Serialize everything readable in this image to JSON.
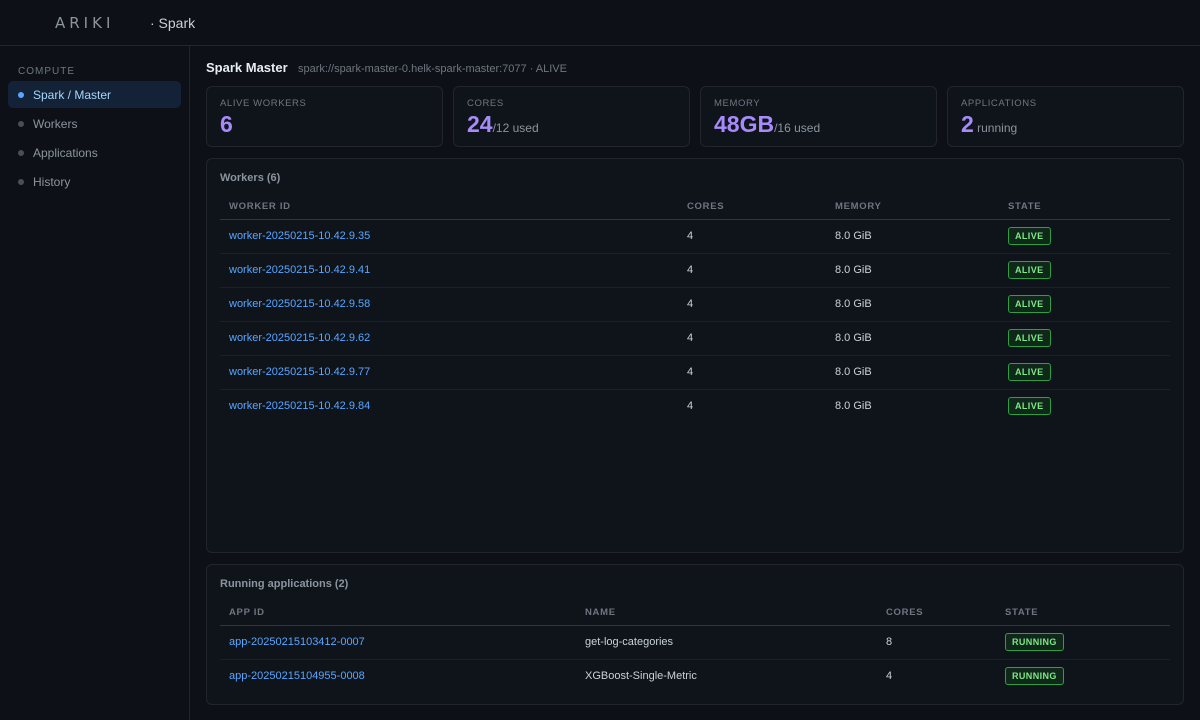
{
  "header": {
    "logo": "ARIKI",
    "app_name": "· Spark"
  },
  "sidebar": {
    "section": "COMPUTE",
    "items": [
      {
        "label": "Spark / Master",
        "active": true
      },
      {
        "label": "Workers",
        "active": false
      },
      {
        "label": "Applications",
        "active": false
      },
      {
        "label": "History",
        "active": false
      }
    ]
  },
  "page": {
    "title": "Spark Master",
    "subtitle": "spark://spark-master-0.helk-spark-master:7077 · ALIVE"
  },
  "stats": [
    {
      "label": "ALIVE WORKERS",
      "value": "6",
      "extra": ""
    },
    {
      "label": "CORES",
      "value": "24",
      "extra": "/12 used"
    },
    {
      "label": "MEMORY",
      "value": "48GB",
      "extra": "/16 used"
    },
    {
      "label": "APPLICATIONS",
      "value": "2",
      "extra": " running"
    }
  ],
  "workers": {
    "title": "Workers (6)",
    "columns": [
      "WORKER ID",
      "CORES",
      "MEMORY",
      "STATE"
    ],
    "rows": [
      {
        "id": "worker-20250215-10.42.9.35",
        "cores": "4",
        "memory": "8.0 GiB",
        "state": "ALIVE"
      },
      {
        "id": "worker-20250215-10.42.9.41",
        "cores": "4",
        "memory": "8.0 GiB",
        "state": "ALIVE"
      },
      {
        "id": "worker-20250215-10.42.9.58",
        "cores": "4",
        "memory": "8.0 GiB",
        "state": "ALIVE"
      },
      {
        "id": "worker-20250215-10.42.9.62",
        "cores": "4",
        "memory": "8.0 GiB",
        "state": "ALIVE"
      },
      {
        "id": "worker-20250215-10.42.9.77",
        "cores": "4",
        "memory": "8.0 GiB",
        "state": "ALIVE"
      },
      {
        "id": "worker-20250215-10.42.9.84",
        "cores": "4",
        "memory": "8.0 GiB",
        "state": "ALIVE"
      }
    ]
  },
  "applications": {
    "title": "Running applications (2)",
    "columns": [
      "APP ID",
      "NAME",
      "CORES",
      "STATE"
    ],
    "rows": [
      {
        "id": "app-20250215103412-0007",
        "name": "get-log-categories",
        "cores": "8",
        "state": "RUNNING"
      },
      {
        "id": "app-20250215104955-0008",
        "name": "XGBoost-Single-Metric",
        "cores": "4",
        "state": "RUNNING"
      }
    ]
  }
}
